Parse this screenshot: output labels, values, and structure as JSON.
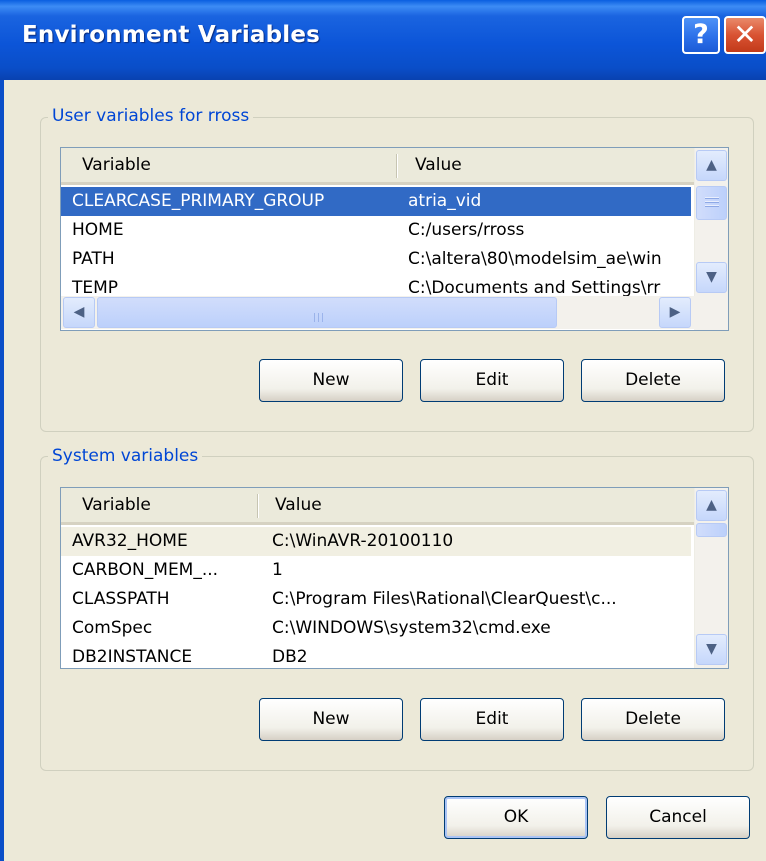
{
  "window": {
    "title": "Environment Variables",
    "help_glyph": "?",
    "close_glyph": "✕"
  },
  "user_group": {
    "label": "User variables for rross",
    "columns": [
      "Variable",
      "Value"
    ],
    "rows": [
      {
        "variable": "CLEARCASE_PRIMARY_GROUP",
        "value": "atria_vid",
        "selected": true
      },
      {
        "variable": "HOME",
        "value": "C:/users/rross",
        "selected": false
      },
      {
        "variable": "PATH",
        "value": "C:\\altera\\80\\modelsim_ae\\win",
        "selected": false
      },
      {
        "variable": "TEMP",
        "value": "C:\\Documents and Settings\\rr",
        "selected": false
      }
    ],
    "buttons": {
      "new": "New",
      "edit": "Edit",
      "delete": "Delete"
    }
  },
  "system_group": {
    "label": "System variables",
    "columns": [
      "Variable",
      "Value"
    ],
    "rows": [
      {
        "variable": "AVR32_HOME",
        "value": "C:\\WinAVR-20100110",
        "selected": false
      },
      {
        "variable": "CARBON_MEM_...",
        "value": "1",
        "selected": false
      },
      {
        "variable": "CLASSPATH",
        "value": "C:\\Program Files\\Rational\\ClearQuest\\c...",
        "selected": false
      },
      {
        "variable": "ComSpec",
        "value": "C:\\WINDOWS\\system32\\cmd.exe",
        "selected": false
      },
      {
        "variable": "DB2INSTANCE",
        "value": "DB2",
        "selected": false
      }
    ],
    "buttons": {
      "new": "New",
      "edit": "Edit",
      "delete": "Delete"
    }
  },
  "footer": {
    "ok": "OK",
    "cancel": "Cancel"
  },
  "icons": {
    "scroll_up": "chevron-up-icon",
    "scroll_down": "chevron-down-icon",
    "scroll_left": "chevron-left-icon",
    "scroll_right": "chevron-right-icon"
  },
  "colors": {
    "titlebar": "#0a4ec8",
    "selection": "#316ac5",
    "group_label": "#0046d5",
    "dialog_bg": "#ece9d8"
  }
}
